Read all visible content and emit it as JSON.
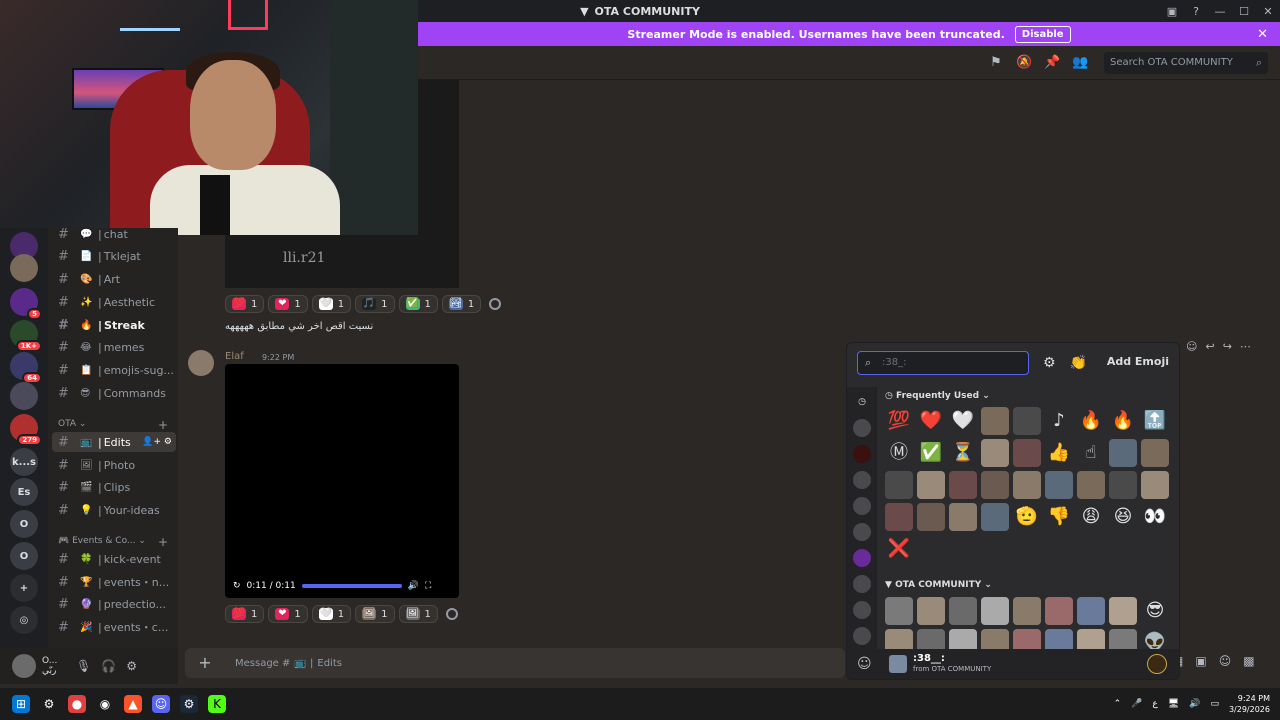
{
  "titlebar": {
    "title": "OTA COMMUNITY"
  },
  "banner": {
    "text": "Streamer Mode is enabled. Usernames have been truncated.",
    "button": "Disable"
  },
  "header": {
    "search_placeholder": "Search OTA COMMUNITY"
  },
  "servers": [
    {
      "label": "",
      "badge": ""
    },
    {
      "label": "",
      "badge": ""
    },
    {
      "label": "",
      "badge": "5"
    },
    {
      "label": "",
      "badge": "1K+"
    },
    {
      "label": "",
      "badge": "64"
    },
    {
      "label": "",
      "badge": ""
    },
    {
      "label": "",
      "badge": "279"
    },
    {
      "label": "k...s",
      "badge": ""
    },
    {
      "label": "Es",
      "badge": ""
    },
    {
      "label": "O",
      "badge": ""
    },
    {
      "label": "O",
      "badge": ""
    }
  ],
  "channels": {
    "top": [
      {
        "emoji": "💬",
        "name": "chat"
      },
      {
        "emoji": "📄",
        "name": "Tklejat"
      },
      {
        "emoji": "🎨",
        "name": "Art"
      },
      {
        "emoji": "✨",
        "name": "Aesthetic"
      },
      {
        "emoji": "🔥",
        "name": "Streak"
      },
      {
        "emoji": "😂",
        "name": "memes"
      },
      {
        "emoji": "📋",
        "name": "emojis-sug..."
      },
      {
        "emoji": "😎",
        "name": "Commands"
      }
    ],
    "category1": "OTA",
    "ota": [
      {
        "emoji": "📺",
        "name": "Edits"
      },
      {
        "emoji": "🖼",
        "name": "Photo"
      },
      {
        "emoji": "🎬",
        "name": "Clips"
      },
      {
        "emoji": "💡",
        "name": "Your-ideas"
      }
    ],
    "category2": "Events & Co...",
    "events": [
      {
        "emoji": "🍀",
        "name": "kick-event"
      },
      {
        "emoji": "🏆",
        "name": "events・n..."
      },
      {
        "emoji": "🔮",
        "name": "predectio..."
      },
      {
        "emoji": "🎉",
        "name": "events・c..."
      }
    ]
  },
  "user": {
    "name": "O...",
    "status": "ربّي"
  },
  "messages": {
    "video1_watermark": "lli.r21",
    "reactions1": [
      {
        "emoji": "💯",
        "count": "1",
        "color": "#e0245e"
      },
      {
        "emoji": "❤",
        "count": "1",
        "color": "#e0245e"
      },
      {
        "emoji": "🤍",
        "count": "1",
        "color": "#ffffff"
      },
      {
        "emoji": "🎵",
        "count": "1",
        "color": "#222222"
      },
      {
        "emoji": "✅",
        "count": "1",
        "color": "#43b581"
      },
      {
        "emoji": "🏞",
        "count": "1",
        "color": "#4a6aa0"
      }
    ],
    "arabic_text": "نسيت اقص اخر شي مطابق هههههه",
    "author": "Elaf",
    "time": "9:22 PM",
    "video2_time": "0:11 / 0:11",
    "reactions2": [
      {
        "emoji": "💯",
        "count": "1",
        "color": "#e0245e"
      },
      {
        "emoji": "❤",
        "count": "1",
        "color": "#e0245e"
      },
      {
        "emoji": "🤍",
        "count": "1",
        "color": "#ffffff"
      },
      {
        "emoji": "🖼",
        "count": "1",
        "color": "#7a6a60"
      },
      {
        "emoji": "🖼",
        "count": "1",
        "color": "#6a6a6a"
      }
    ]
  },
  "composer": {
    "placeholder": "Message #",
    "channel": "Edits"
  },
  "picker": {
    "search_placeholder": ":38_:",
    "add_label": "Add Emoji",
    "frequent_label": "Frequently Used",
    "server_label": "OTA COMMUNITY",
    "frequent": [
      "💯",
      "❤️",
      "🤍",
      "🖼",
      "🖼",
      "♪",
      "🔥",
      "🔥",
      "🔝",
      "Ⓜ",
      "✅",
      "⏳",
      "🖼",
      "🖼",
      "👍",
      "☝",
      "🖼",
      "🖼",
      "🖼",
      "🖼",
      "🖼",
      "🖼",
      "🖼",
      "🖼",
      "🖼",
      "🖼",
      "🖼",
      "🖼",
      "🖼",
      "🖼",
      "🖼",
      "🫡",
      "👎",
      "😩",
      "😆",
      "👀",
      "❌"
    ],
    "server": [
      "🖼",
      "🖼",
      "🖼",
      "🖼",
      "🖼",
      "🖼",
      "🖼",
      "🖼",
      "😎",
      "🖼",
      "🖼",
      "🖼",
      "🖼",
      "🖼",
      "🖼",
      "🖼",
      "🖼",
      "👽"
    ],
    "footer_name": ":38__:",
    "footer_from": "from OTA COMMUNITY"
  },
  "taskbar": {
    "time": "9:24 PM",
    "date": "3/29/2026",
    "lang": "ع"
  }
}
